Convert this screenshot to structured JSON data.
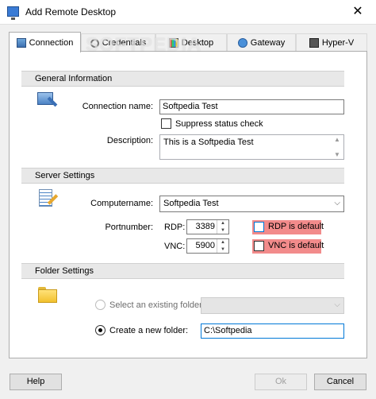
{
  "window": {
    "title": "Add Remote Desktop",
    "close_glyph": "✕",
    "icon": "remote-desktop-icon"
  },
  "watermark": "SOFTPEDIA",
  "tabs": [
    {
      "label": "Connection",
      "icon": "connection-icon",
      "active": true
    },
    {
      "label": "Credentials",
      "icon": "credentials-icon",
      "active": false
    },
    {
      "label": "Desktop",
      "icon": "desktop-icon",
      "active": false
    },
    {
      "label": "Gateway",
      "icon": "gateway-icon",
      "active": false
    },
    {
      "label": "Hyper-V",
      "icon": "hyper-v-icon",
      "active": false
    }
  ],
  "general": {
    "header": "General Information",
    "connection_name_label": "Connection name:",
    "connection_name_value": "Softpedia Test",
    "suppress_label": "Suppress status check",
    "suppress_checked": false,
    "description_label": "Description:",
    "description_value": "This is a Softpedia Test"
  },
  "server": {
    "header": "Server Settings",
    "computername_label": "Computername:",
    "computername_value": "Softpedia Test",
    "portnumber_label": "Portnumber:",
    "rdp_label": "RDP:",
    "rdp_value": "3389",
    "rdp_default_label": "RDP is default",
    "vnc_label": "VNC:",
    "vnc_value": "5900",
    "vnc_default_label": "VNC is default",
    "warning_color": "#f28b8b"
  },
  "folder": {
    "header": "Folder Settings",
    "existing_label": "Select an existing folder:",
    "existing_value": "",
    "new_label": "Create a new folder:",
    "new_value": "C:\\Softpedia",
    "selected": "new"
  },
  "footer": {
    "help_label": "Help",
    "ok_label": "Ok",
    "cancel_label": "Cancel"
  }
}
